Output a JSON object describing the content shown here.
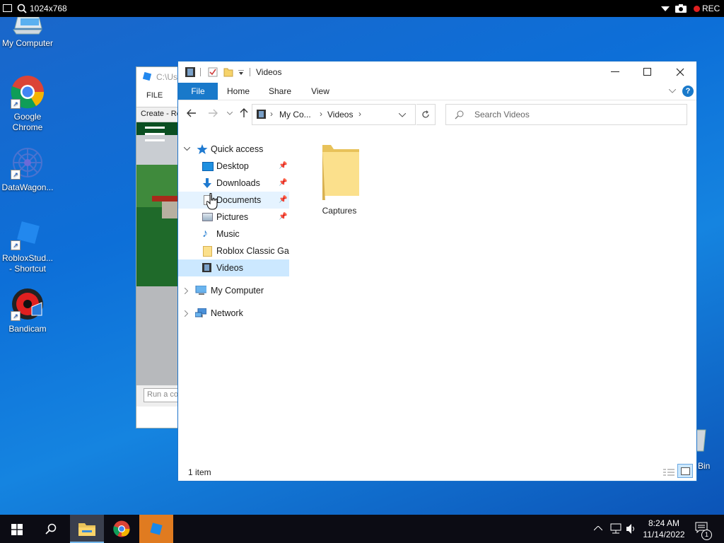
{
  "recorder": {
    "resolution": "1024x768",
    "rec_label": "REC"
  },
  "desktop": {
    "icons": [
      {
        "label": "My Computer",
        "icon": "computer-icon"
      },
      {
        "label": "Google Chrome",
        "icon": "chrome-icon"
      },
      {
        "label": "DataWagon...",
        "icon": "datawagon-icon"
      },
      {
        "label": "RobloxStud... - Shortcut",
        "icon": "roblox-studio-icon"
      },
      {
        "label": "Bandicam",
        "icon": "bandicam-icon"
      },
      {
        "label": "Bin",
        "icon": "recycle-bin-icon"
      }
    ]
  },
  "background_window": {
    "path": "C:\\Us",
    "menu_file": "FILE",
    "tab": "Create - Ro",
    "command": "Run a co"
  },
  "explorer": {
    "title": "Videos",
    "ribbon": [
      "File",
      "Home",
      "Share",
      "View"
    ],
    "breadcrumb": [
      "My Co...",
      "Videos"
    ],
    "search_placeholder": "Search Videos",
    "nav": {
      "quick_access": "Quick access",
      "items": [
        {
          "label": "Desktop",
          "pinned": true
        },
        {
          "label": "Downloads",
          "pinned": true
        },
        {
          "label": "Documents",
          "pinned": true
        },
        {
          "label": "Pictures",
          "pinned": true
        },
        {
          "label": "Music",
          "pinned": false
        },
        {
          "label": "Roblox Classic Gam",
          "pinned": false
        },
        {
          "label": "Videos",
          "pinned": false,
          "selected": true
        }
      ],
      "my_computer": "My Computer",
      "network": "Network"
    },
    "content": {
      "items": [
        {
          "label": "Captures",
          "icon": "folder-icon"
        }
      ]
    },
    "status": "1 item",
    "accent": "#1979ca",
    "selection": "#cce8ff"
  },
  "taskbar": {
    "time": "8:24 AM",
    "date": "11/14/2022",
    "notification_count": "1"
  }
}
